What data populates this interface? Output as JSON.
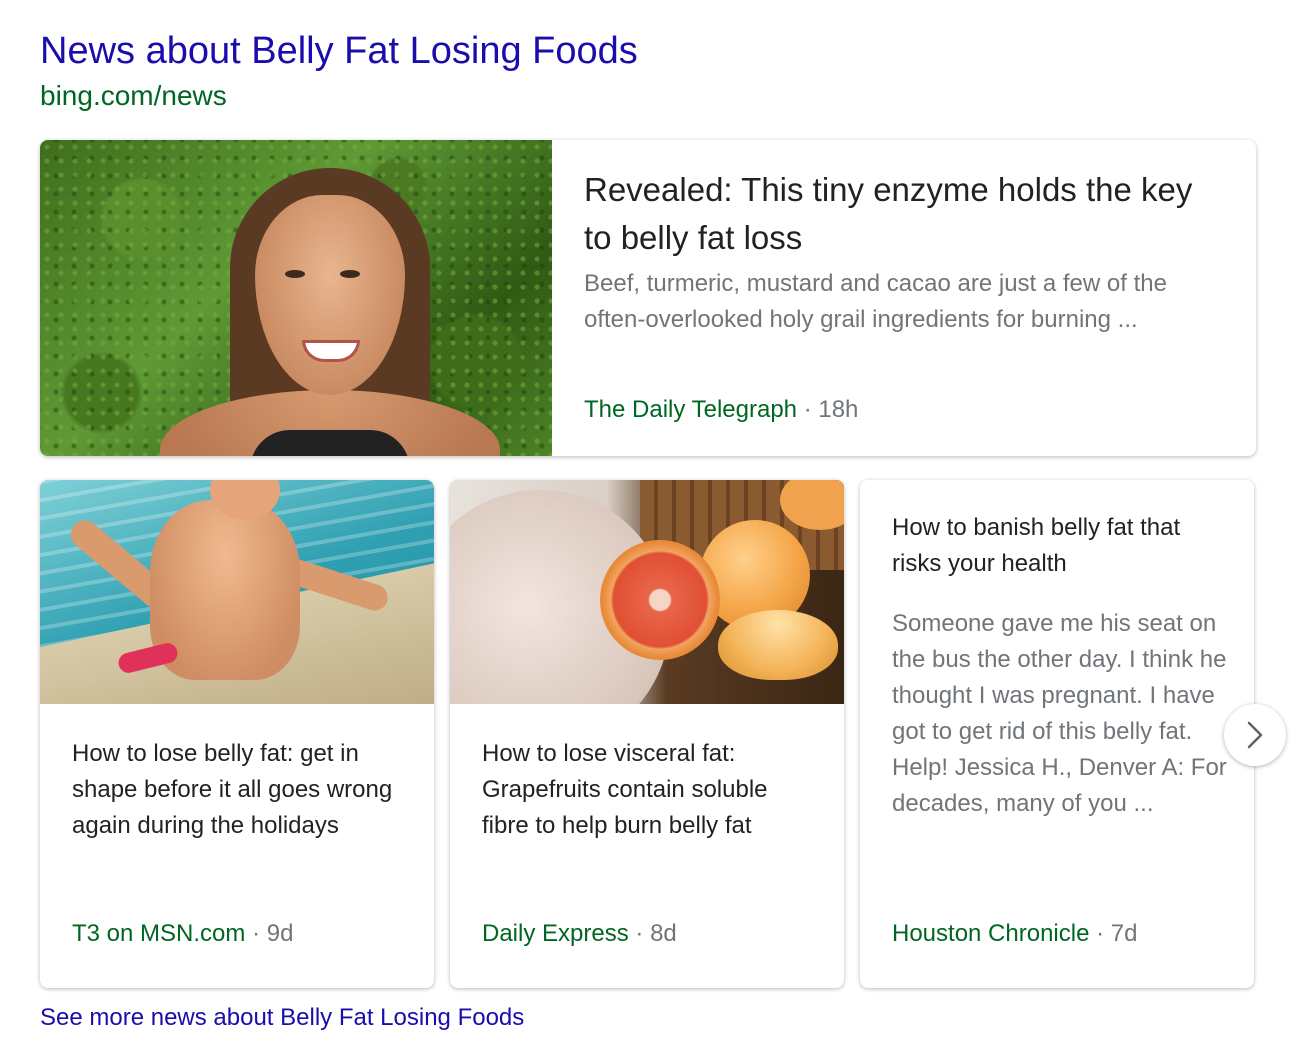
{
  "header": {
    "title": "News about Belly Fat Losing Foods",
    "url": "bing.com/news"
  },
  "featured": {
    "title": "Revealed: This tiny enzyme holds the key to belly fat loss",
    "snippet": "Beef, turmeric, mustard and cacao are just a few of the often-overlooked holy grail ingredients for burning ...",
    "source": "The Daily Telegraph",
    "separator": "·",
    "age": "18h"
  },
  "cards": [
    {
      "title": "How to lose belly fat: get in shape before it all goes wrong again during the holidays",
      "source": "T3 on MSN.com",
      "separator": "·",
      "age": "9d"
    },
    {
      "title": "How to lose visceral fat: Grapefruits contain soluble fibre to help burn belly fat",
      "source": "Daily Express",
      "separator": "·",
      "age": "8d"
    },
    {
      "title": "How to banish belly fat that risks your health",
      "snippet": "Someone gave me his seat on the bus the other day. I think he thought I was pregnant. I have got to get rid of this belly fat. Help! Jessica H., Denver A: For decades, many of you ...",
      "source": "Houston Chronicle",
      "separator": "·",
      "age": "7d"
    }
  ],
  "footer": {
    "see_more": "See more news about Belly Fat Losing Foods"
  },
  "icons": {
    "next": "chevron-right-icon"
  },
  "colors": {
    "link": "#1a0dab",
    "source": "#006621",
    "muted": "#70757a",
    "title": "#222222"
  }
}
